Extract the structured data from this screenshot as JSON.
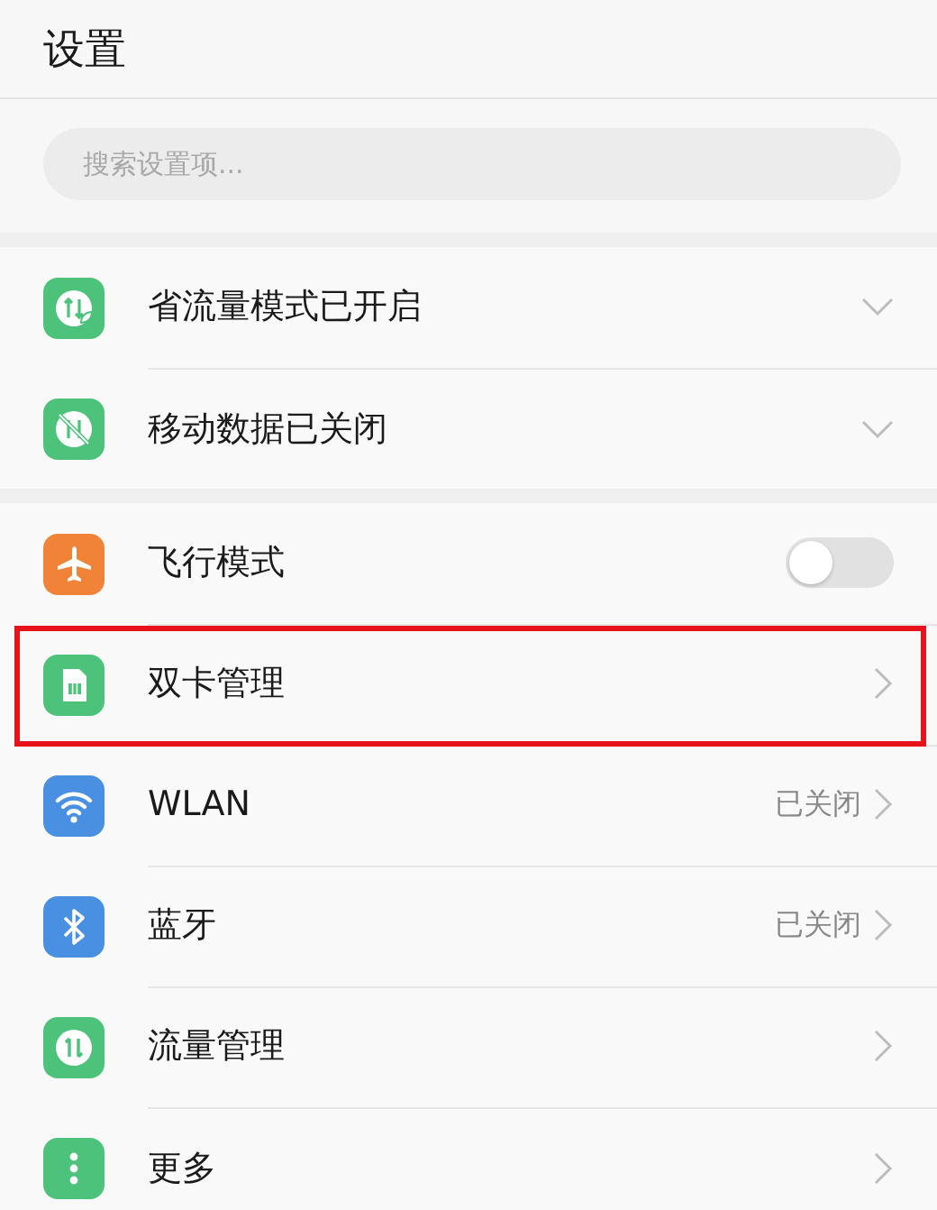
{
  "header": {
    "title": "设置"
  },
  "search": {
    "placeholder": "搜索设置项..."
  },
  "groups": [
    {
      "items": [
        {
          "label": "省流量模式已开启",
          "color": "#4cc27a",
          "kind": "expand",
          "highlighted": false
        },
        {
          "label": "移动数据已关闭",
          "color": "#4cc27a",
          "kind": "expand",
          "highlighted": false
        }
      ]
    },
    {
      "items": [
        {
          "label": "飞行模式",
          "color": "#f08338",
          "kind": "toggle",
          "on": false,
          "highlighted": false
        },
        {
          "label": "双卡管理",
          "color": "#4cc27a",
          "kind": "link",
          "highlighted": true
        },
        {
          "label": "WLAN",
          "color": "#4a90e2",
          "kind": "link",
          "status": "已关闭",
          "highlighted": false
        },
        {
          "label": "蓝牙",
          "color": "#4a90e2",
          "kind": "link",
          "status": "已关闭",
          "highlighted": false
        },
        {
          "label": "流量管理",
          "color": "#4cc27a",
          "kind": "link",
          "highlighted": false
        },
        {
          "label": "更多",
          "color": "#4cc27a",
          "kind": "link",
          "highlighted": false
        }
      ]
    }
  ]
}
